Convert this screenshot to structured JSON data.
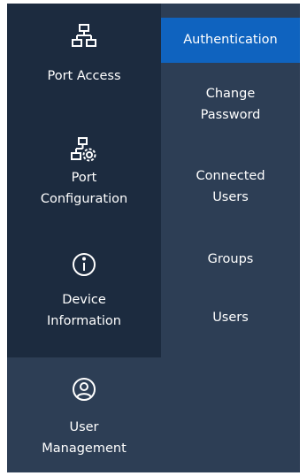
{
  "nav": {
    "items": [
      {
        "label": "Port Access",
        "icon": "network-hierarchy-icon"
      },
      {
        "label": "Port\nConfiguration",
        "icon": "network-settings-icon"
      },
      {
        "label": "Device\nInformation",
        "icon": "info-icon"
      },
      {
        "label": "User\nManagement",
        "icon": "user-circle-icon"
      }
    ]
  },
  "submenu": {
    "items": [
      {
        "label": "Authentication",
        "active": true
      },
      {
        "label": "Change\nPassword",
        "active": false
      },
      {
        "label": "Connected\nUsers",
        "active": false
      },
      {
        "label": "Groups",
        "active": false
      },
      {
        "label": "Users",
        "active": false
      }
    ]
  },
  "colors": {
    "left_panel": "#1c2b3f",
    "right_panel": "#2d3e55",
    "active_item": "#0f63bf",
    "text": "#ffffff"
  }
}
